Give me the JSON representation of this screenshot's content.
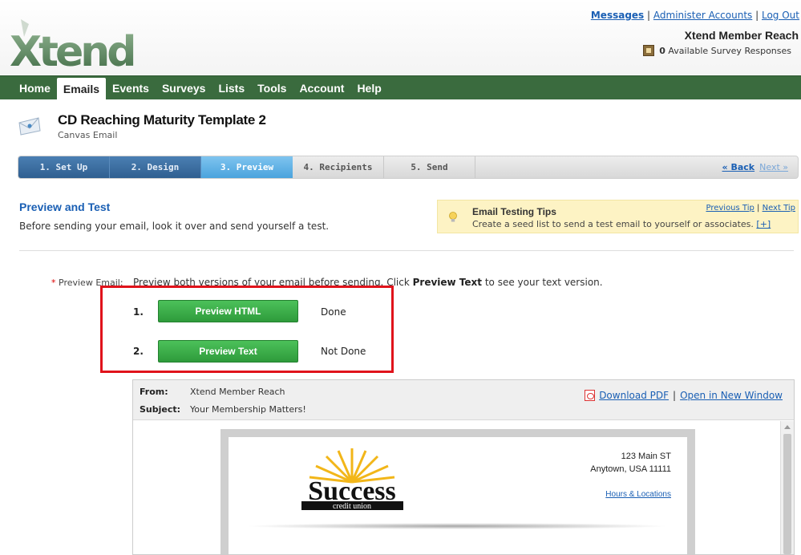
{
  "header": {
    "brand": "Xtend",
    "links": {
      "messages": "Messages",
      "sep1": "|",
      "administer": "Administer Accounts",
      "sep2": "|",
      "logout": "Log Out"
    },
    "member_name": "Xtend Member Reach",
    "survey_count": "0",
    "survey_text": "Available Survey Responses"
  },
  "nav": {
    "items": [
      {
        "label": "Home",
        "active": false
      },
      {
        "label": "Emails",
        "active": true
      },
      {
        "label": "Events",
        "active": false
      },
      {
        "label": "Surveys",
        "active": false
      },
      {
        "label": "Lists",
        "active": false
      },
      {
        "label": "Tools",
        "active": false
      },
      {
        "label": "Account",
        "active": false
      },
      {
        "label": "Help",
        "active": false
      }
    ]
  },
  "page": {
    "title": "CD Reaching Maturity Template 2",
    "subtitle": "Canvas Email"
  },
  "wizard": {
    "steps": [
      {
        "label": "1. Set Up",
        "state": "done"
      },
      {
        "label": "2. Design",
        "state": "done"
      },
      {
        "label": "3. Preview",
        "state": "current"
      },
      {
        "label": "4. Recipients",
        "state": "todo"
      },
      {
        "label": "5. Send",
        "state": "todo"
      }
    ],
    "back": "« Back",
    "next": "Next »"
  },
  "section": {
    "title": "Preview and Test",
    "description": "Before sending your email, look it over and send yourself a test."
  },
  "tip": {
    "title": "Email Testing Tips",
    "text": "Create a seed list to send a test email to yourself or associates.",
    "expand": "[+]",
    "previous": "Previous Tip",
    "sep": "|",
    "next": "Next Tip"
  },
  "preview": {
    "required_mark": "*",
    "label": "Preview Email:",
    "instr_before": "Preview both versions of your email before sending.  Click ",
    "instr_bold": "Preview Text",
    "instr_after": " to see your text version.",
    "rows": [
      {
        "num": "1.",
        "button": "Preview HTML",
        "status": "Done"
      },
      {
        "num": "2.",
        "button": "Preview Text",
        "status": "Not Done"
      }
    ]
  },
  "email_preview": {
    "from_label": "From:",
    "from_value": "Xtend Member Reach",
    "subject_label": "Subject:",
    "subject_value": "Your Membership Matters!",
    "download_pdf": "Download PDF",
    "sep": "|",
    "open_window": "Open in New Window",
    "logo_word": "Success",
    "logo_sub": "credit union",
    "address_line1": "123 Main ST",
    "address_line2": "Anytown, USA 11111",
    "hours_link": "Hours & Locations"
  },
  "colors": {
    "nav_green": "#3a6b3e",
    "link_blue": "#1a5fb4",
    "button_green": "#2e9b3b",
    "highlight_red": "#e0131b",
    "tip_yellow": "#fdf3c4"
  }
}
